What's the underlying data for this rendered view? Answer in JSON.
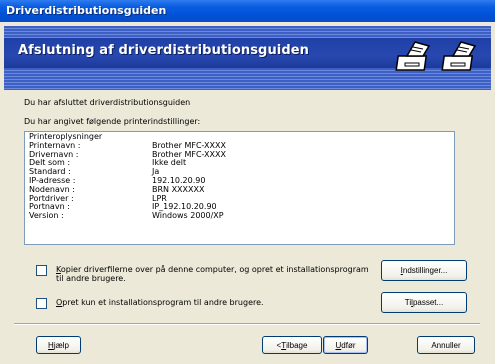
{
  "window": {
    "title": "Driverdistributionsguiden"
  },
  "banner": {
    "heading": "Afslutning af driverdistributionsguiden",
    "icons": [
      "printer-icon",
      "printer-icon"
    ]
  },
  "main": {
    "finished_text": "Du har afsluttet driverdistributionsguiden",
    "settings_intro": "Du har angivet følgende printerindstillinger:",
    "list": {
      "heading": "Printeroplysninger",
      "rows": [
        {
          "key": "Printernavn :",
          "value": "Brother MFC-XXXX"
        },
        {
          "key": "Drivernavn :",
          "value": "Brother MFC-XXXX"
        },
        {
          "key": "Delt som :",
          "value": "Ikke delt"
        },
        {
          "key": "Standard :",
          "value": "Ja"
        },
        {
          "key": "IP-adresse :",
          "value": "192.10.20.90"
        },
        {
          "key": "Nodenavn :",
          "value": "BRN XXXXXX"
        },
        {
          "key": "Portdriver :",
          "value": "LPR"
        },
        {
          "key": "Portnavn :",
          "value": "IP_192.10.20.90"
        },
        {
          "key": "Version :",
          "value": "Windows 2000/XP"
        }
      ]
    },
    "options": {
      "copy_files": {
        "label_first": "K",
        "label_rest_line1": "opier driverfilerne over på denne computer, og opret et installationsprogram",
        "label_line2": "til andre brugere.",
        "button_first": "I",
        "button_rest": "ndstillinger..."
      },
      "installer_only": {
        "label_first": "O",
        "label_rest": "pret kun et installationsprogram til andre brugere.",
        "button_pre": "Ti",
        "button_ul": "l",
        "button_post": "passet..."
      }
    }
  },
  "footer": {
    "help_first": "H",
    "help_rest": "jælp",
    "back_pre": "< ",
    "back_ul": "T",
    "back_post": "ilbage",
    "finish_ul": "U",
    "finish_post": "dfør",
    "cancel": "Annuller"
  }
}
